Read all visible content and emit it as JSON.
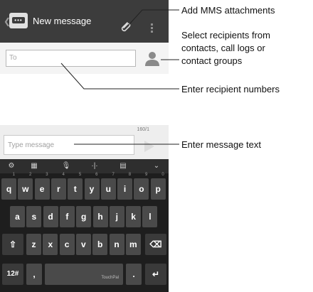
{
  "screen": {
    "title": "New message",
    "to_placeholder": "To",
    "counter": "160/1",
    "message_placeholder": "Type message"
  },
  "icons": [
    "back-chevron-icon",
    "app-icon",
    "paperclip-icon",
    "overflow-menu-icon",
    "contact-person-icon",
    "send-icon",
    "settings-icon",
    "input-switch-icon",
    "microphone-icon",
    "cursor-icon",
    "clipboard-icon",
    "hide-keyboard-icon",
    "shift-icon",
    "backspace-icon",
    "enter-icon"
  ],
  "keyboard": {
    "row1": [
      "q",
      "w",
      "e",
      "r",
      "t",
      "y",
      "u",
      "i",
      "o",
      "p"
    ],
    "row1_hints": [
      "1",
      "2",
      "3",
      "4",
      "5",
      "6",
      "7",
      "8",
      "9",
      "0"
    ],
    "row2": [
      "a",
      "s",
      "d",
      "f",
      "g",
      "h",
      "j",
      "k",
      "l"
    ],
    "row3": [
      "z",
      "x",
      "c",
      "v",
      "b",
      "n",
      "m"
    ],
    "symbols_key": "12#",
    "comma_key": ",",
    "period_key": ".",
    "space_label": "TouchPal"
  },
  "annotations": {
    "mms": "Add MMS attachments",
    "recipients_from": [
      "Select recipients from",
      "contacts, call logs or",
      "contact groups"
    ],
    "enter_numbers": "Enter recipient numbers",
    "enter_text": "Enter message text"
  },
  "colors": {
    "action_bar": "#3c3c3c",
    "keyboard_bg": "#1e1e1e",
    "key_bg": "#4a4a4a"
  }
}
